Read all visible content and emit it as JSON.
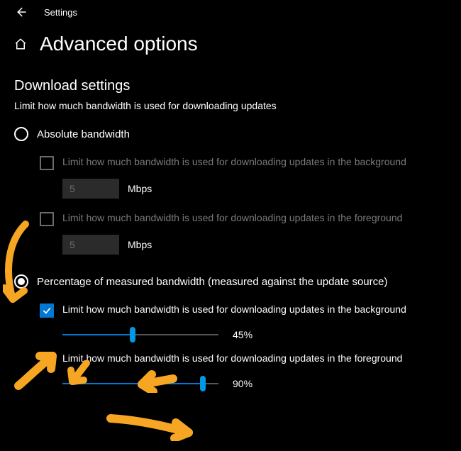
{
  "app_title": "Settings",
  "page_title": "Advanced options",
  "section_title": "Download settings",
  "description": "Limit how much bandwidth is used for downloading updates",
  "radio": {
    "absolute": "Absolute bandwidth",
    "percentage": "Percentage of measured bandwidth (measured against the update source)"
  },
  "absolute": {
    "bg_check_label": "Limit how much bandwidth is used for downloading updates in the background",
    "bg_value": "5",
    "bg_unit": "Mbps",
    "fg_check_label": "Limit how much bandwidth is used for downloading updates in the foreground",
    "fg_value": "5",
    "fg_unit": "Mbps"
  },
  "percentage": {
    "bg_check_label": "Limit how much bandwidth is used for downloading updates in the background",
    "bg_value": "45%",
    "bg_percent": 45,
    "fg_check_label": "Limit how much bandwidth is used for downloading updates in the foreground",
    "fg_value": "90%",
    "fg_percent": 90
  },
  "annotation_color": "#f6a623"
}
